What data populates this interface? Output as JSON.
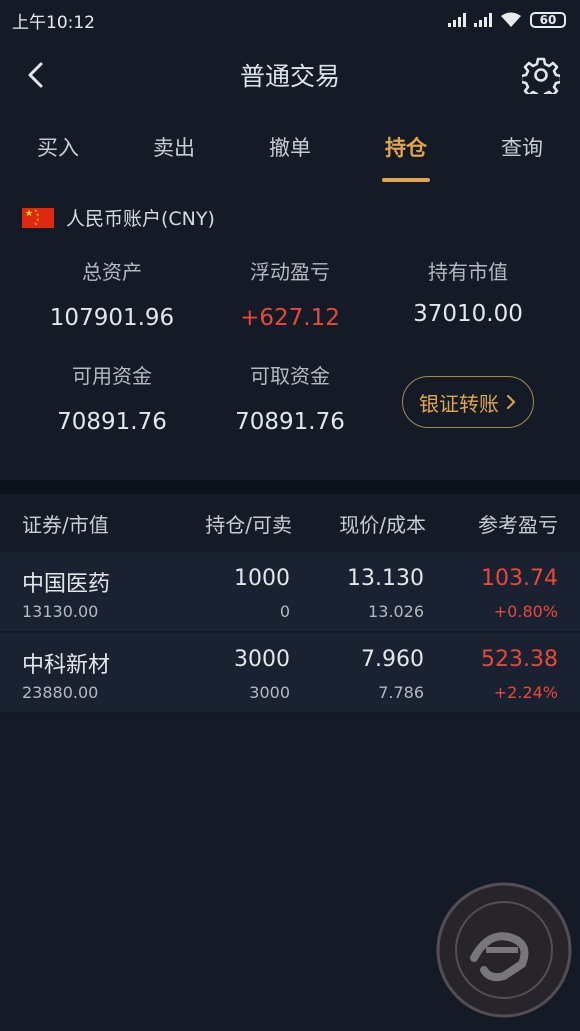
{
  "status_bar": {
    "time": "上午10:12",
    "battery": "60"
  },
  "nav": {
    "title": "普通交易"
  },
  "tabs": [
    "买入",
    "卖出",
    "撤单",
    "持仓",
    "查询"
  ],
  "active_tab": "持仓",
  "account": {
    "label": "人民币账户(CNY)"
  },
  "summary": {
    "total_assets": {
      "label": "总资产",
      "value": "107901.96"
    },
    "floating_pnl": {
      "label": "浮动盈亏",
      "value": "+627.12"
    },
    "market_value": {
      "label": "持有市值",
      "value": "37010.00"
    },
    "available_funds": {
      "label": "可用资金",
      "value": "70891.76"
    },
    "withdrawable_funds": {
      "label": "可取资金",
      "value": "70891.76"
    },
    "transfer_button": "银证转账"
  },
  "table": {
    "headers": [
      "证券/市值",
      "持仓/可卖",
      "现价/成本",
      "参考盈亏"
    ],
    "rows": [
      {
        "name": "中国医药",
        "market_value": "13130.00",
        "position": "1000",
        "sellable": "0",
        "price": "13.130",
        "cost": "13.026",
        "pnl": "103.74",
        "pnl_pct": "+0.80%"
      },
      {
        "name": "中科新材",
        "market_value": "23880.00",
        "position": "3000",
        "sellable": "3000",
        "price": "7.960",
        "cost": "7.786",
        "pnl": "523.38",
        "pnl_pct": "+2.24%"
      }
    ]
  },
  "colors": {
    "accent": "#e0a64c",
    "gain": "#e8493a",
    "background": "#141a26"
  }
}
